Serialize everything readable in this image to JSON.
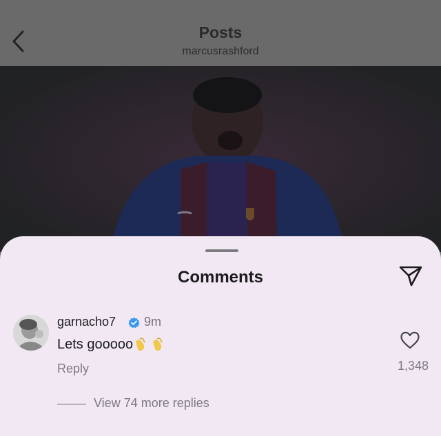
{
  "header": {
    "title": "Posts",
    "subtitle": "marcusrashford",
    "back_icon": "chevron-left-icon"
  },
  "post": {
    "image_description_icon": "player-photo"
  },
  "comments_sheet": {
    "title": "Comments",
    "share_icon": "paper-plane-icon",
    "comment": {
      "username": "garnacho7",
      "verified": true,
      "time": "9m",
      "text": "Lets gooooo",
      "emoji": "pinched-fingers-emoji",
      "reply_label": "Reply",
      "like_icon": "heart-outline-icon",
      "like_count": "1,348",
      "view_replies_label": "View 74 more replies"
    }
  },
  "colors": {
    "sheet_bg": "#f1e8f4",
    "verified_blue": "#3897f0",
    "overlay": "#6a6a6a"
  }
}
